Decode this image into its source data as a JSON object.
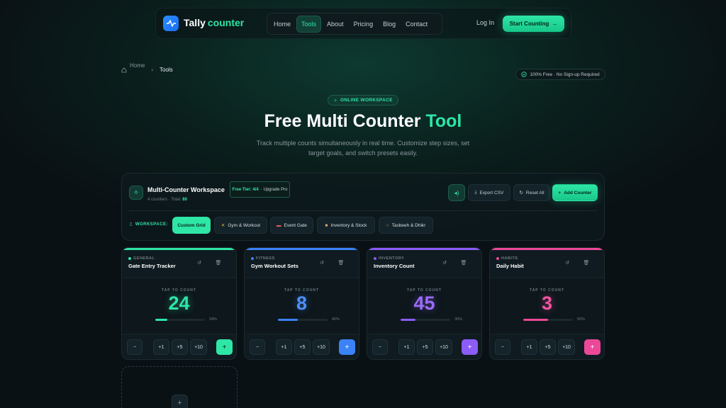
{
  "nav": {
    "brand": "Tally",
    "brand_accent": "counter",
    "menu": [
      "Home",
      "Tools",
      "About",
      "Pricing",
      "Blog",
      "Contact"
    ],
    "active_menu": "Tools",
    "login": "Log In",
    "cta": "Start Counting"
  },
  "breadcrumb": {
    "home": "Home",
    "current": "Tools"
  },
  "free_pill": "100% Free · No Sign-up Required",
  "hero": {
    "badge": "ONLINE WORKSPACE",
    "title": "Free Multi Counter",
    "title_accent": "Tool",
    "subtitle": "Track multiple counts simultaneously in real time. Customize step sizes, set target goals, and switch presets easily."
  },
  "workspace": {
    "title": "Multi-Counter Workspace",
    "tier": "Free Tier: 4/4",
    "upgrade": "· Upgrade Pro",
    "meta": "4 counters · Total:",
    "total": "80",
    "export": "Export CSV",
    "reset": "Reset All",
    "add": "Add Counter",
    "label": "WORKSPACE:",
    "presets": [
      "Custom Grid",
      "Gym & Workout",
      "Event Gate",
      "Inventory & Stock",
      "Tasbeeh & Dhikr"
    ]
  },
  "cards": [
    {
      "category": "GENERAL",
      "name": "Gate Entry Tracker",
      "count": "24",
      "progress": "24%",
      "progress_value": 0.24,
      "color": "#2ee6a6"
    },
    {
      "category": "FITNESS",
      "name": "Gym Workout Sets",
      "count": "8",
      "progress": "40%",
      "progress_value": 0.4,
      "color": "#3b82f6"
    },
    {
      "category": "INVENTORY",
      "name": "Inventory Count",
      "count": "45",
      "progress": "30%",
      "progress_value": 0.3,
      "color": "#8b5cf6"
    },
    {
      "category": "HABITS",
      "name": "Daily Habit",
      "count": "3",
      "progress": "50%",
      "progress_value": 0.5,
      "color": "#ec4899"
    }
  ],
  "card_labels": {
    "tap": "TAP TO COUNT",
    "minus": "−",
    "p1": "+1",
    "p5": "+5",
    "p10": "+10",
    "plus": "+"
  },
  "new_counter": "+"
}
